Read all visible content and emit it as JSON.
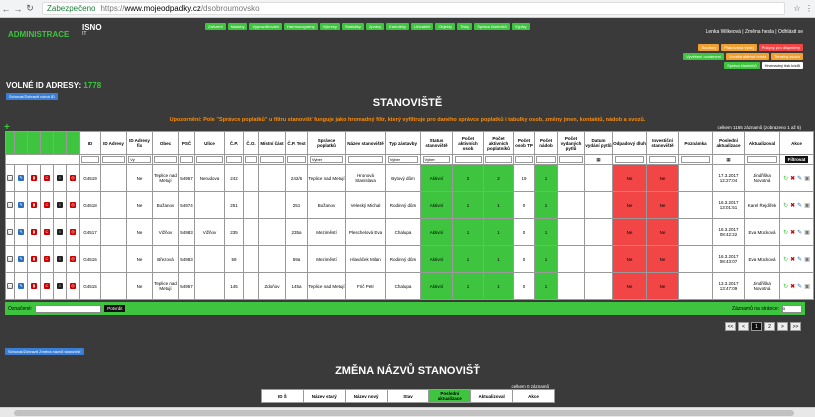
{
  "browser": {
    "secure_label": "Zabezpečeno",
    "url_prefix": "https://",
    "url_domain": "www.mojeodpadky.cz",
    "url_path": "/dsobroumovsko"
  },
  "header": {
    "admin_title": "ADMINISTRACE",
    "logo_text": "ISNO",
    "logo_sub": "IT",
    "menu": [
      "Zařízení",
      "Nádoby",
      "Vyprazdňování",
      "Harmonogramy",
      "Výkresy",
      "Statistiky",
      "Zprávy",
      "Kartotéky",
      "Uživatelé",
      "Objekty",
      "Tisky",
      "Správa číselníků",
      "Výpisy"
    ],
    "userline": "Lenka Wilkeová | Změna hesla | Odhlásit se",
    "buttons_row1": [
      {
        "label": "Soubory",
        "color": "#f0a030"
      },
      {
        "label": "Plánovaná výdej",
        "color": "#f0a030"
      },
      {
        "label": "Pokyny pro dispečery",
        "color": "#f24545"
      }
    ],
    "buttons_row2": [
      {
        "label": "Vyvěšení oznámení",
        "color": "#3ec43e"
      },
      {
        "label": "Vozidla sběrné místa",
        "color": "#f0a030"
      },
      {
        "label": "Termíny svozu",
        "color": "#f0a030"
      }
    ],
    "buttons_row3": [
      {
        "label": "Správa číselníků",
        "color": "#3ec43e"
      },
      {
        "label": "Hromadný tisk kódů",
        "color": "#ffffff"
      }
    ]
  },
  "volne": {
    "label": "VOLNÉ ID ADRESY:",
    "value": "1778"
  },
  "volne_btn": "Schovat/Zobrazit volná ID",
  "title": "STANOVIŠTĚ",
  "note": "Upozornění: Pole \"Správce poplatků\" u filtru stanovišť funguje jako hromadný filtr, který vyfiltruje pro daného správce poplatků i tabulky osob, změny jmen, kontaktů, nádob a svozů.",
  "count": "celkem 1165 záznamů (zobrazeno 1 až 5)",
  "columns": [
    "",
    "",
    "",
    "",
    "",
    "",
    "ID",
    "ID Adresy",
    "ID Adresy fix",
    "Obec",
    "PSČ",
    "Ulice",
    "Č.P.",
    "Č.O.",
    "Místní část",
    "Č.P. Text",
    "Správce poplatků",
    "Název stanoviště",
    "Typ zástavby",
    "Status stanoviště",
    "Počet aktivních osob",
    "Počet aktivních poplatníků",
    "Počet osob TP",
    "Počet nádob",
    "Počet vydaných pytlů",
    "Datum vydání pytlů",
    "Odpadový dluh",
    "Investiční stanoviště",
    "Poznámka",
    "Poslední aktualizace",
    "Aktualizoval",
    "Akce"
  ],
  "filter": {
    "idfix": "Vy",
    "spravce": "Vyber",
    "typ": "Vyber",
    "status": "Vyber",
    "btn": "Filtrovat"
  },
  "rows": [
    {
      "id": "G4519",
      "idfix": "Ne",
      "obec": "Teplice nad Metují",
      "psc": "54957",
      "ulice": "Nerudova",
      "cp": "242",
      "co": "",
      "cast": "",
      "cptext": "242/6",
      "spravce": "Teplice nad Metují",
      "nazev": "Hronová Stanislava",
      "typ": "Bytový dům",
      "status": "Aktivní",
      "osob": "2",
      "popl": "2",
      "tp": "19",
      "nadob": "1",
      "pytlu": "",
      "datum": "",
      "dluh": "Ne",
      "invest": "Ne",
      "pozn": "",
      "aktualizace": "17.3.2017 12:27:04",
      "autor": "Jindřiška Novotná"
    },
    {
      "id": "G4518",
      "idfix": "Ne",
      "obec": "Božanov",
      "psc": "54974",
      "ulice": "",
      "cp": "251",
      "co": "",
      "cast": "",
      "cptext": "251",
      "spravce": "Božanov",
      "nazev": "Veleský Michal",
      "typ": "Rodinný dům",
      "status": "Aktivní",
      "osob": "1",
      "popl": "1",
      "tp": "0",
      "nadob": "1",
      "pytlu": "",
      "datum": "",
      "dluh": "Ne",
      "invest": "Ne",
      "pozn": "",
      "aktualizace": "16.3.2017 13:01:51",
      "autor": "Karel Řejdířek"
    },
    {
      "id": "G4517",
      "idfix": "Ne",
      "obec": "Vižňov",
      "psc": "54983",
      "ulice": "Vižňov",
      "cp": "235",
      "co": "",
      "cast": "",
      "cptext": "235a",
      "spravce": "Meziměstí",
      "nazev": "Pleschelová Eva",
      "typ": "Chalupa",
      "status": "Aktivní",
      "osob": "1",
      "popl": "1",
      "tp": "0",
      "nadob": "1",
      "pytlu": "",
      "datum": "",
      "dluh": "Ne",
      "invest": "Ne",
      "pozn": "",
      "aktualizace": "16.3.2017 08:42:22",
      "autor": "Eva Mücková"
    },
    {
      "id": "G4516",
      "idfix": "Ne",
      "obec": "Březová",
      "psc": "54983",
      "ulice": "",
      "cp": "59",
      "co": "",
      "cast": "",
      "cptext": "59a",
      "spravce": "Meziměstí",
      "nazev": "Hlaváček Milan",
      "typ": "Rodinný dům",
      "status": "Aktivní",
      "osob": "1",
      "popl": "1",
      "tp": "0",
      "nadob": "1",
      "pytlu": "",
      "datum": "",
      "dluh": "Ne",
      "invest": "Ne",
      "pozn": "",
      "aktualizace": "16.3.2017 08:43:07",
      "autor": "Eva Mücková"
    },
    {
      "id": "G4515",
      "idfix": "Ne",
      "obec": "Teplice nad Metují",
      "psc": "54957",
      "ulice": "",
      "cp": "145",
      "co": "",
      "cast": "Zdoňov",
      "cptext": "145a",
      "spravce": "Teplice nad Metují",
      "nazev": "Frič Petr",
      "typ": "Chalupa",
      "status": "Aktivní",
      "osob": "1",
      "popl": "1",
      "tp": "0",
      "nadob": "1",
      "pytlu": "",
      "datum": "",
      "dluh": "Ne",
      "invest": "Ne",
      "pozn": "",
      "aktualizace": "13.3.2017 13:47:09",
      "autor": "Jindřiška Novotná"
    }
  ],
  "bottombar": {
    "label": "Označené:",
    "btn": "Potvrdit",
    "right_label": "Záznamů na stránce:",
    "per_page": "5"
  },
  "pager": [
    "<<",
    "<",
    "1",
    "2",
    ">",
    ">>"
  ],
  "section2_btn": "Schovat/Zobrazit Změna názvů stanovišť",
  "section2_title": "ZMĚNA NÁZVŮ STANOVIŠŤ",
  "section2_count": "celkem 0 záznamů",
  "section2_columns": [
    "ID Š",
    "Název starý",
    "Název nový",
    "Stav",
    "Poslední aktualizace",
    "Aktualizoval",
    "Akce"
  ]
}
